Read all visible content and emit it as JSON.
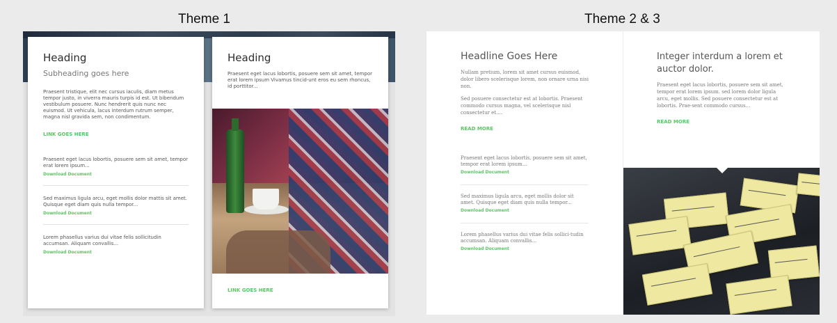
{
  "theme1": {
    "title": "Theme 1",
    "card1": {
      "heading": "Heading",
      "subheading": "Subheading goes here",
      "body": "Praesent tristique, elit nec cursus iaculis, diam metus tempor justo, in viverra mauris turpis id est. Ut bibendum vestibulum posuere. Nunc hendrerit quis nunc nec euismod. Ut vehicula, lacus interdum rutrum semper, magna nisl gravida sem, non condimentum.",
      "link": "LINK GOES HERE",
      "items": [
        {
          "text": "Praesent eget lacus lobortis, posuere sem sit amet, tempor erat lorem ipsum...",
          "link": "Download Document"
        },
        {
          "text": "Sed maximus ligula arcu, eget mollis dolor mattis sit amet. Quisque eget diam quis nulla tempor...",
          "link": "Download Document"
        },
        {
          "text": "Lorem phasellus varius dui vitae felis sollicitudin accumsan. Aliquam convallis...",
          "link": "Download Document"
        }
      ]
    },
    "card2": {
      "heading": "Heading",
      "body": "Praesent eget lacus lobortis, posuere sem sit amet, tempor erat lorem ipsum  Vivamus tincid-unt eros eu sem rhoncus, id porttitor...",
      "link": "LINK GOES HERE"
    }
  },
  "theme2": {
    "title": "Theme 2 & 3",
    "left": {
      "headline": "Headline Goes Here",
      "p1": "Nullam pretium, lorem sit amet cursus euismod, dolor libero scelerisque lorem, non ornare urna nisi non.",
      "p2": "Sed posuere consectetur est at lobortis. Praesent commodo cursus magna, vel scelerisque nisl consectetur et....",
      "link": "READ MORE",
      "items": [
        {
          "text": "Praesent eget lacus lobortis, posuere sem sit amet, tempor erat lorem ipsum...",
          "link": "Download Document"
        },
        {
          "text": "Sed maximus ligula arcu, eget mollis dolor sit amet. Quisque eget diam quis nulla tempor...",
          "link": "Download Document"
        },
        {
          "text": "Lorem phasellus varius dui vitae felis sollici-tudin accumsan. Aliquam convallis...",
          "link": "Download Document"
        }
      ]
    },
    "right": {
      "headline": "Integer interdum a lorem et auctor dolor.",
      "body": "Praesent eget lacus lobortis, posuere sem sit amet, tempor erat lorem ipsum. sed lorem dolor ligula arcu, eget mollis. Sed posuere consectetur est at lobortis. Prae-sent commodo cursus...",
      "link": "READ MORE"
    }
  },
  "colors": {
    "accent": "#5cc565",
    "background": "#ebebeb"
  }
}
